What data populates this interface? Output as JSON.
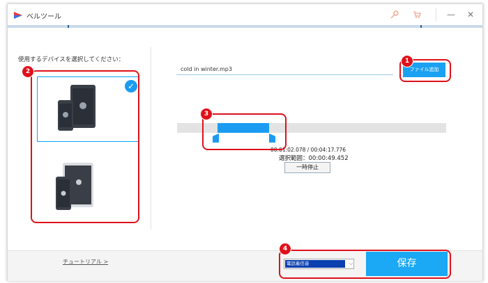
{
  "titlebar": {
    "app_title": "ベルツール",
    "icons": [
      "key-icon",
      "cart-icon"
    ],
    "minimize_glyph": "—",
    "close_glyph": "✕"
  },
  "left": {
    "heading": "使用するデバイスを選択してください：",
    "devices": [
      {
        "name": "android",
        "selected": true
      },
      {
        "name": "apple",
        "selected": false
      }
    ]
  },
  "main": {
    "file_name": "cold in winter.mp3",
    "add_file_label": "ファイル追加",
    "time_display": "00:01:02.078 / 00:04:17.776",
    "selection_range": "選択範囲：00:00:49.452",
    "pause_label": "一時停止"
  },
  "footer": {
    "tutorial_link": "チュートリアル >",
    "ringtone_select": "電話着信音",
    "save_label": "保存"
  },
  "annotations": [
    "1",
    "2",
    "3",
    "4"
  ],
  "colors": {
    "accent": "#1ba1f2",
    "annotation": "#e0101a",
    "select_highlight": "#0a3fb0"
  }
}
